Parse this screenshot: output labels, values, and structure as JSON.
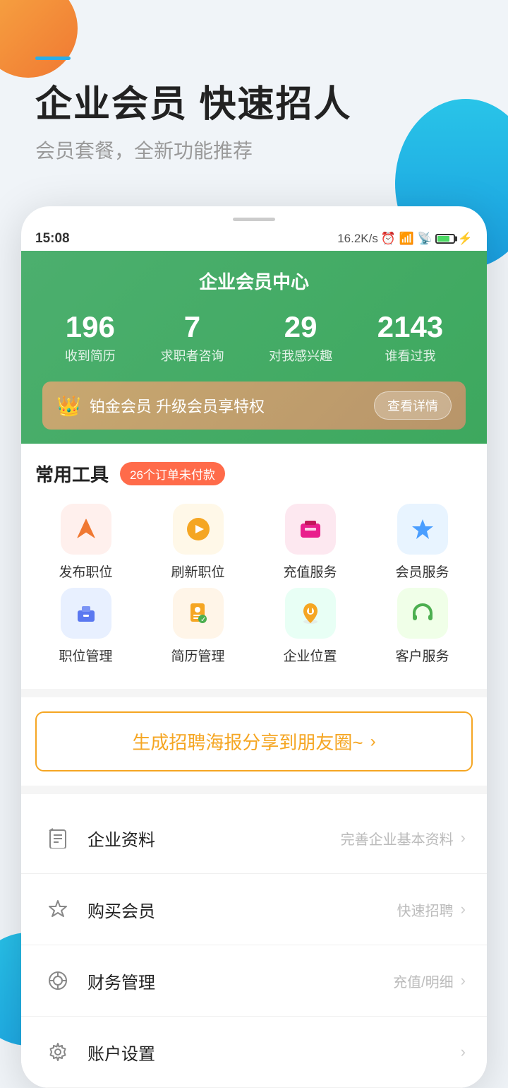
{
  "page": {
    "background_circles": {
      "orange": "top-left decorative",
      "blue_top": "top-right decorative",
      "blue_bottom": "bottom-left decorative"
    }
  },
  "header": {
    "accent_line": true,
    "title": "企业会员  快速招人",
    "subtitle": "会员套餐，全新功能推荐"
  },
  "status_bar": {
    "time": "15:08",
    "speed": "16.2K/s",
    "battery_percent": "78"
  },
  "member_center": {
    "title": "企业会员中心",
    "stats": [
      {
        "number": "196",
        "label": "收到简历"
      },
      {
        "number": "7",
        "label": "求职者咨询"
      },
      {
        "number": "29",
        "label": "对我感兴趣"
      },
      {
        "number": "2143",
        "label": "谁看过我"
      }
    ],
    "vip_banner": {
      "icon": "👑",
      "text": "铂金会员  升级会员享特权",
      "button": "查看详情"
    }
  },
  "tools_section": {
    "title": "常用工具",
    "badge": "26个订单未付款",
    "tools_row1": [
      {
        "label": "发布职位",
        "icon": "📤",
        "color_class": "icon-publish"
      },
      {
        "label": "刷新职位",
        "icon": "⚡",
        "color_class": "icon-refresh"
      },
      {
        "label": "充值服务",
        "icon": "💳",
        "color_class": "icon-recharge"
      },
      {
        "label": "会员服务",
        "icon": "👑",
        "color_class": "icon-member"
      }
    ],
    "tools_row2": [
      {
        "label": "职位管理",
        "icon": "💼",
        "color_class": "icon-manage"
      },
      {
        "label": "简历管理",
        "icon": "📋",
        "color_class": "icon-resume"
      },
      {
        "label": "企业位置",
        "icon": "📍",
        "color_class": "icon-location"
      },
      {
        "label": "客户服务",
        "icon": "🎧",
        "color_class": "icon-service"
      }
    ]
  },
  "poster_banner": {
    "text": "生成招聘海报分享到朋友圈~",
    "arrow": "›"
  },
  "menu_items": [
    {
      "id": "company-info",
      "icon": "📝",
      "label": "企业资料",
      "sub_label": "完善企业基本资料",
      "arrow": "›"
    },
    {
      "id": "buy-member",
      "icon": "🔷",
      "label": "购买会员",
      "sub_label": "快速招聘",
      "arrow": "›"
    },
    {
      "id": "finance",
      "icon": "💰",
      "label": "财务管理",
      "sub_label": "充值/明细",
      "arrow": "›"
    },
    {
      "id": "account-settings",
      "icon": "⚙️",
      "label": "账户设置",
      "sub_label": "",
      "arrow": "›"
    }
  ]
}
